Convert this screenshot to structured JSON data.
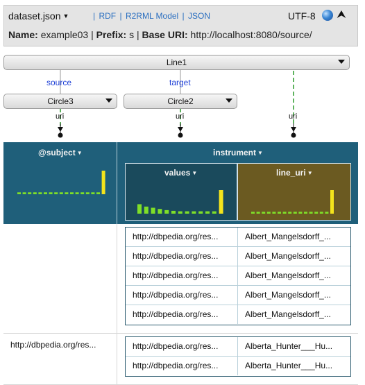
{
  "header": {
    "dataset_label": "dataset.json",
    "links": [
      "RDF",
      "R2RML Model",
      "JSON"
    ],
    "encoding": "UTF-8",
    "name_label": "Name:",
    "name_value": "example03",
    "prefix_label": "Prefix:",
    "prefix_value": "s",
    "base_uri_label": "Base URI:",
    "base_uri_value": "http://localhost:8080/source/"
  },
  "graph": {
    "top_node": "Line1",
    "source_edge": "source",
    "target_edge": "target",
    "left_node": "Circle3",
    "middle_node": "Circle2",
    "uri_labels": [
      "uri",
      "uri",
      "uri"
    ]
  },
  "columns": {
    "subject": {
      "title": "@subject",
      "histogram": [
        0.08,
        0.08,
        0.08,
        0.08,
        0.08,
        0.08,
        0.08,
        0.08,
        0.08,
        0.08,
        0.08,
        0.08,
        0.08,
        0.08,
        0.08,
        0.08,
        1.0
      ]
    },
    "instrument": {
      "title": "instrument"
    },
    "values": {
      "title": "values",
      "histogram": [
        0.4,
        0.3,
        0.25,
        0.2,
        0.15,
        0.12,
        0.1,
        0.1,
        0.1,
        0.1,
        0.1,
        0.1,
        1.0
      ]
    },
    "line_uri": {
      "title": "line_uri",
      "histogram": [
        0.08,
        0.08,
        0.08,
        0.08,
        0.08,
        0.08,
        0.08,
        0.08,
        0.08,
        0.08,
        0.08,
        0.08,
        0.08,
        0.08,
        0.08,
        1.0
      ]
    }
  },
  "rows": [
    {
      "subject": "",
      "nested": [
        {
          "values": "http://dbpedia.org/res...",
          "line_uri": "Albert_Mangelsdorff_..."
        },
        {
          "values": "http://dbpedia.org/res...",
          "line_uri": "Albert_Mangelsdorff_..."
        },
        {
          "values": "http://dbpedia.org/res...",
          "line_uri": "Albert_Mangelsdorff_..."
        },
        {
          "values": "http://dbpedia.org/res...",
          "line_uri": "Albert_Mangelsdorff_..."
        },
        {
          "values": "http://dbpedia.org/res...",
          "line_uri": "Albert_Mangelsdorff_..."
        }
      ]
    },
    {
      "subject": "http://dbpedia.org/res...",
      "nested": [
        {
          "values": "http://dbpedia.org/res...",
          "line_uri": "Alberta_Hunter___Hu..."
        },
        {
          "values": "http://dbpedia.org/res...",
          "line_uri": "Alberta_Hunter___Hu..."
        }
      ]
    }
  ],
  "colors": {
    "header_dark": "#1f5f7a",
    "values_header": "#1a4a5c",
    "line_uri_header": "#6b5a21",
    "histogram_green": "#7fdf28",
    "histogram_yellow": "#f4e41c",
    "link_blue": "#2b6fc0"
  }
}
